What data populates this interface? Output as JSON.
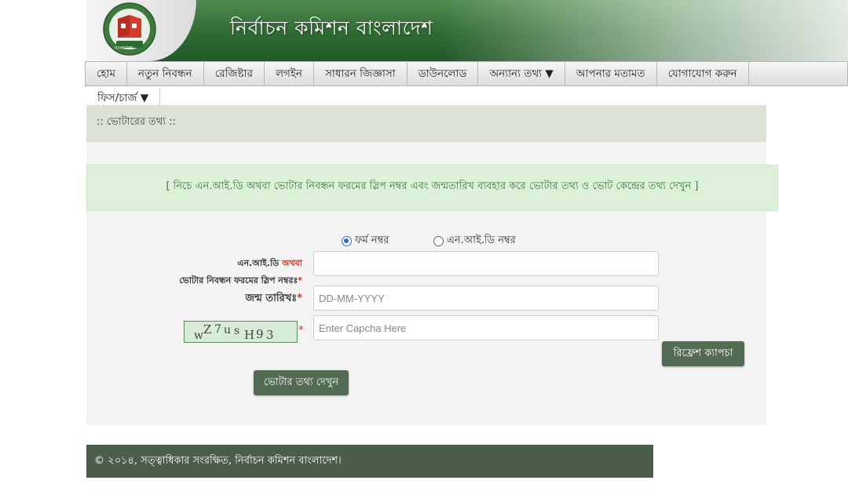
{
  "header": {
    "site_title": "নির্বাচন কমিশন বাংলাদেশ",
    "logo_text": "বাংলাদেশ"
  },
  "nav": {
    "items": [
      {
        "label": "হোম"
      },
      {
        "label": "নতুন নিবন্ধন"
      },
      {
        "label": "রেজিষ্টার"
      },
      {
        "label": "লগইন"
      },
      {
        "label": "সাধারন জিজ্ঞাসা"
      },
      {
        "label": "ডাউনলোড"
      },
      {
        "label": "অন্যান্য তথ্য ▼"
      },
      {
        "label": "আপনার মতামত"
      },
      {
        "label": "যোগাযোগ করুন"
      }
    ],
    "second_row": [
      {
        "label": "ফিস/চার্জ ▼"
      }
    ]
  },
  "section": {
    "title": ":: ভোটারের তথ্য ::"
  },
  "notice": {
    "text": "[ নিচে এন.আই.ডি অথবা ভোটার নিবন্ধন ফরমের স্লিপ নম্বর এবং জন্মতারিখ ব্যবহার করে ভোটার তথ্য ও ভোট কেন্দ্রের তথ্য দেখুন ]"
  },
  "form": {
    "radio_form": {
      "label": "ফর্ম নম্বর",
      "checked": true
    },
    "radio_nid": {
      "label": "এন.আই.ডি নম্বর",
      "checked": false
    },
    "id_label_part1": "এন.আই.ডি",
    "id_label_or": "অথবা",
    "id_label_part2": "ভোটার নিবন্ধন ফরমের স্লিপ নম্বরঃ",
    "id_value": "",
    "dob_label": "জন্ম তারিখঃ",
    "dob_placeholder": "DD-MM-YYYY",
    "dob_value": "",
    "captcha_text": "wZ7us H93",
    "captcha_placeholder": "Enter Capcha Here",
    "captcha_value": "",
    "required_mark": "*",
    "refresh_button": "রিফ্রেশ ক্যাপচা",
    "submit_button": "ভোটার তথ্য দেখুন"
  },
  "footer": {
    "text": "© ২০১৪, সত্ত্বাধিকার সংরক্ষিত, নির্বাচন কমিশন বাংলাদেশ।"
  },
  "colors": {
    "brand_green": "#2f6a33",
    "button": "#536a53",
    "notice_bg": "#ddf0da",
    "section_bg": "#dbe2d3",
    "required": "#c0392b"
  }
}
